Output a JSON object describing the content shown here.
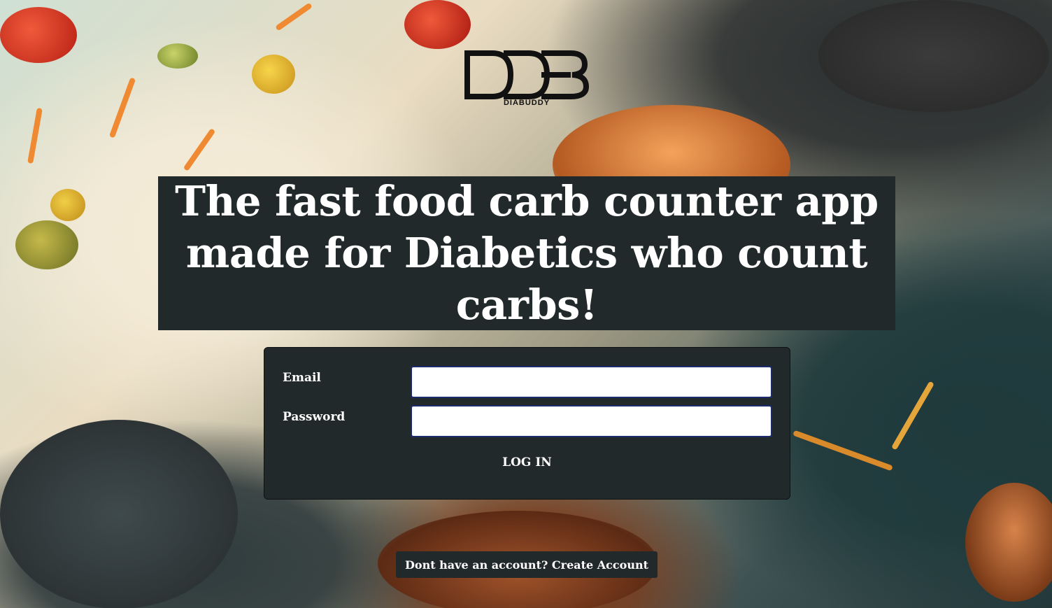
{
  "brand": {
    "logo_monogram": "DDB",
    "logo_text": "DIABUDDY"
  },
  "hero": {
    "headline": "The fast food carb counter app made for Diabetics who count carbs!"
  },
  "login_form": {
    "email_label": "Email",
    "email_value": "",
    "password_label": "Password",
    "password_value": "",
    "login_button": "LOG IN"
  },
  "footer": {
    "create_account_link": "Dont have an account? Create Account"
  },
  "colors": {
    "panel_background": "#22292b",
    "text": "#ffffff",
    "input_border": "#1c2b6e"
  },
  "background": {
    "description_icon": "food-explosion-illustration"
  }
}
